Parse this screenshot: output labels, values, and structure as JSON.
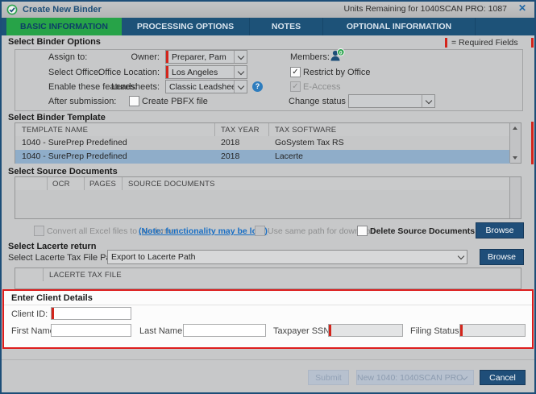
{
  "window": {
    "title": "Create New Binder",
    "units_remaining": "Units Remaining for 1040SCAN PRO: 1087",
    "close_glyph": "✕"
  },
  "tabs": {
    "basic": "BASIC INFORMATION",
    "processing": "PROCESSING OPTIONS",
    "notes": "NOTES",
    "optional": "OPTIONAL INFORMATION"
  },
  "legend": {
    "required": "= Required Fields"
  },
  "binder_options": {
    "title": "Select Binder Options",
    "assign_to": "Assign to:",
    "owner": "Owner:",
    "owner_value": "Preparer, Pam",
    "members": "Members:",
    "members_count": "0",
    "select_office": "Select Office:",
    "office_location": "Office Location:",
    "office_location_value": "Los Angeles",
    "restrict_by_office": "Restrict by Office",
    "enable_features": "Enable these features:",
    "leadsheets": "Leadsheets:",
    "leadsheets_value": "Classic Leadsheets",
    "help_glyph": "?",
    "e_access": "E-Access",
    "after_submission": "After submission:",
    "create_pbfx": "Create PBFX file",
    "change_status": "Change status to:",
    "change_status_value": ""
  },
  "binder_template": {
    "title": "Select Binder Template",
    "col_template_name": "TEMPLATE NAME",
    "col_tax_year": "TAX YEAR",
    "col_tax_software": "TAX SOFTWARE",
    "rows": [
      {
        "name": "1040 - SurePrep Predefined",
        "year": "2018",
        "software": "GoSystem Tax RS"
      },
      {
        "name": "1040 - SurePrep Predefined",
        "year": "2018",
        "software": "Lacerte"
      }
    ],
    "selected_row": 1
  },
  "source_documents": {
    "title": "Select Source Documents",
    "col_ocr": "OCR",
    "col_pages": "PAGES",
    "col_source_documents": "SOURCE DOCUMENTS",
    "convert_excel": "Convert all Excel files to .xls format",
    "note_link": "(Note: functionality may be lost)",
    "use_same_path": "Use same path for download",
    "delete_source_documents": "Delete Source Documents",
    "browse": "Browse"
  },
  "lacerte": {
    "title": "Select Lacerte return",
    "path_label": "Select Lacerte Tax File Path:",
    "path_value": "Export to Lacerte Path",
    "browse": "Browse",
    "col_tax_file": "LACERTE TAX FILE"
  },
  "client_details": {
    "title": "Enter Client Details",
    "client_id": "Client ID:",
    "client_id_value": "",
    "first_name": "First Name:",
    "first_name_value": "",
    "last_name": "Last Name:",
    "last_name_value": "",
    "taxpayer_ssn": "Taxpayer SSN:",
    "taxpayer_ssn_value": "",
    "filing_status": "Filing Status:",
    "filing_status_value": ""
  },
  "footer": {
    "submit": "Submit",
    "binder_type": "New 1040: 1040SCAN PRO",
    "cancel": "Cancel"
  },
  "colors": {
    "accent_blue": "#1f4e79",
    "tab_bar_blue": "#1d5278",
    "active_tab_green": "#27a348",
    "required_red": "#d3251c",
    "selected_row_blue": "#8fadc9",
    "link_blue": "#1a6fc4",
    "client_box_border_red": "#dd1d1d"
  }
}
